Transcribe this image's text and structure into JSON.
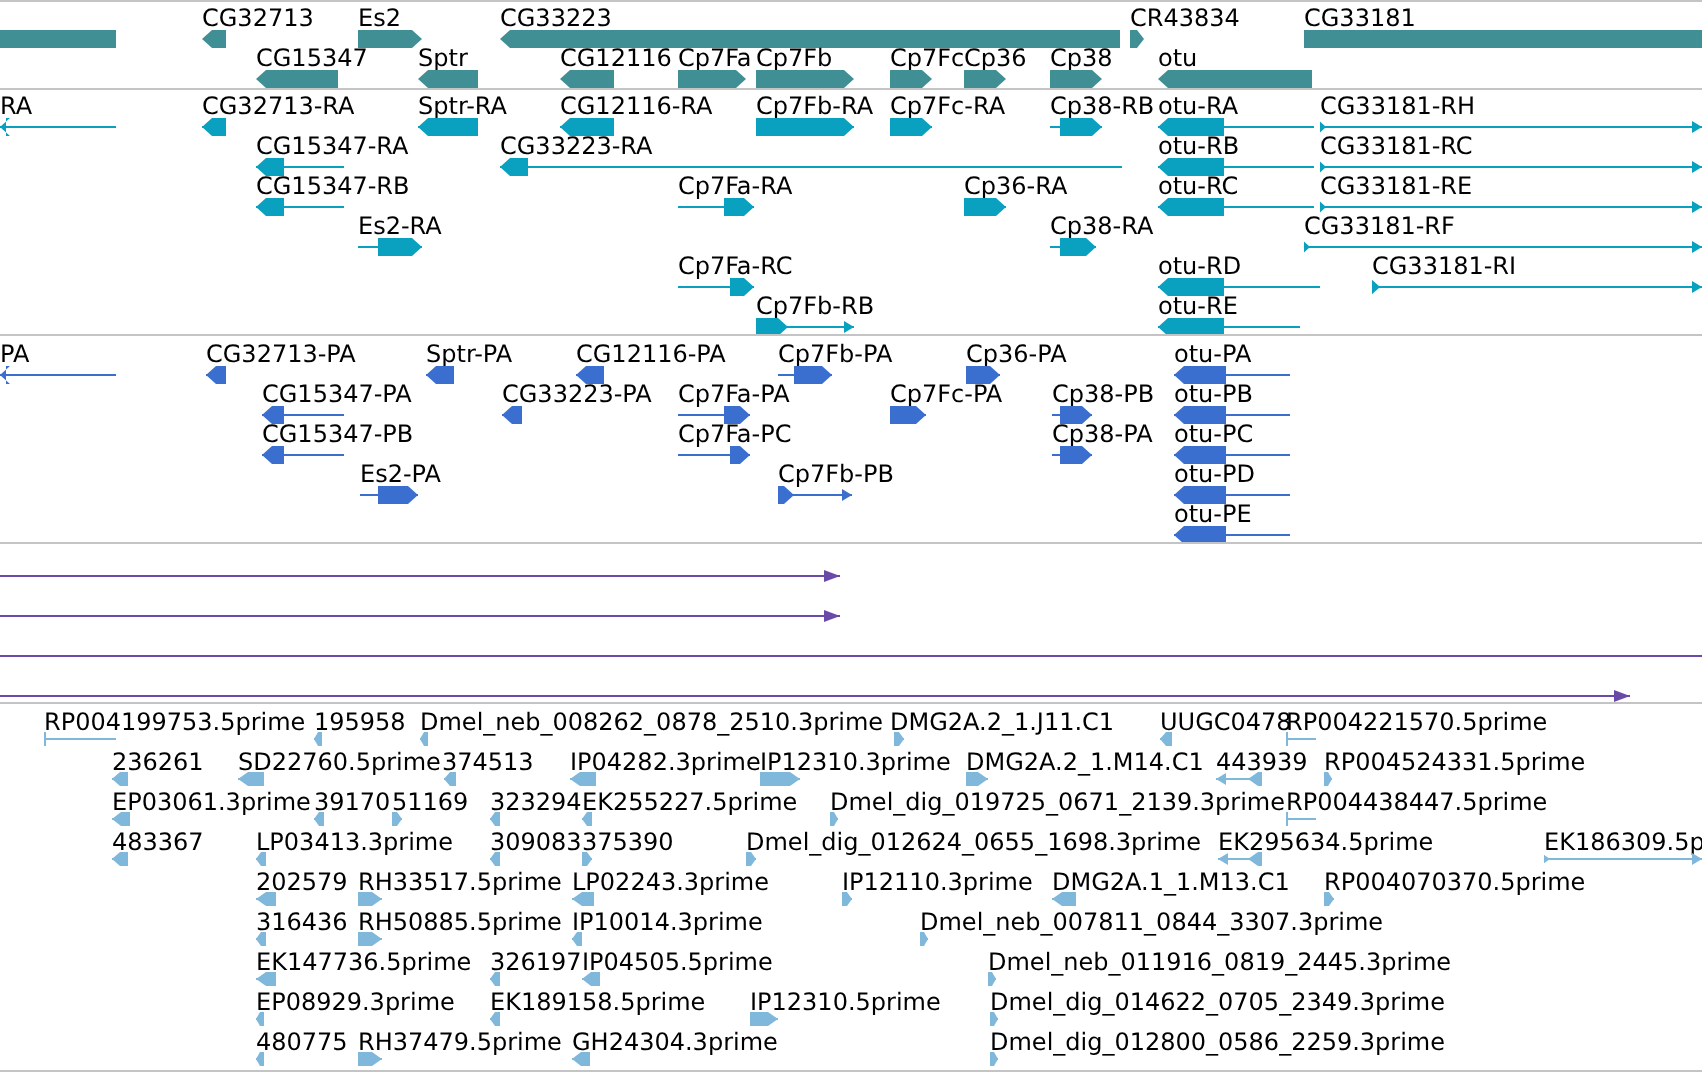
{
  "tracks": [
    {
      "kind": "genes",
      "features": [
        {
          "label": "CG32713"
        },
        {
          "label": "Es2"
        },
        {
          "label": "CG33223"
        },
        {
          "label": "CR43834"
        },
        {
          "label": "CG33181"
        },
        {
          "label": "CG15347"
        },
        {
          "label": "Sptr"
        },
        {
          "label": "CG12116"
        },
        {
          "label": "Cp7Fa"
        },
        {
          "label": "Cp7Fb"
        },
        {
          "label": "Cp7Fc"
        },
        {
          "label": "Cp36"
        },
        {
          "label": "Cp38"
        },
        {
          "label": "otu"
        }
      ]
    },
    {
      "kind": "transcripts",
      "features": [
        {
          "label": "RA"
        },
        {
          "label": "CG32713-RA"
        },
        {
          "label": "Sptr-RA"
        },
        {
          "label": "CG12116-RA"
        },
        {
          "label": "Cp7Fb-RA"
        },
        {
          "label": "Cp7Fc-RA"
        },
        {
          "label": "Cp38-RB"
        },
        {
          "label": "otu-RA"
        },
        {
          "label": "CG33181-RH"
        },
        {
          "label": "CG15347-RA"
        },
        {
          "label": "CG33223-RA"
        },
        {
          "label": "otu-RB"
        },
        {
          "label": "CG33181-RC"
        },
        {
          "label": "CG15347-RB"
        },
        {
          "label": "Cp7Fa-RA"
        },
        {
          "label": "Cp36-RA"
        },
        {
          "label": "otu-RC"
        },
        {
          "label": "CG33181-RE"
        },
        {
          "label": "Es2-RA"
        },
        {
          "label": "Cp38-RA"
        },
        {
          "label": "CG33181-RF"
        },
        {
          "label": "Cp7Fa-RC"
        },
        {
          "label": "otu-RD"
        },
        {
          "label": "CG33181-RI"
        },
        {
          "label": "Cp7Fb-RB"
        },
        {
          "label": "otu-RE"
        }
      ]
    },
    {
      "kind": "proteins",
      "features": [
        {
          "label": "PA"
        },
        {
          "label": "CG32713-PA"
        },
        {
          "label": "Sptr-PA"
        },
        {
          "label": "CG12116-PA"
        },
        {
          "label": "Cp7Fb-PA"
        },
        {
          "label": "Cp36-PA"
        },
        {
          "label": "otu-PA"
        },
        {
          "label": "CG15347-PA"
        },
        {
          "label": "CG33223-PA"
        },
        {
          "label": "Cp7Fa-PA"
        },
        {
          "label": "Cp7Fc-PA"
        },
        {
          "label": "Cp38-PB"
        },
        {
          "label": "otu-PB"
        },
        {
          "label": "CG15347-PB"
        },
        {
          "label": "Cp7Fa-PC"
        },
        {
          "label": "Cp38-PA"
        },
        {
          "label": "otu-PC"
        },
        {
          "label": "Es2-PA"
        },
        {
          "label": "Cp7Fb-PB"
        },
        {
          "label": "otu-PD"
        },
        {
          "label": "otu-PE"
        }
      ]
    },
    {
      "kind": "alignments"
    },
    {
      "kind": "ests",
      "features": [
        {
          "label": "RP004199753.5prime"
        },
        {
          "label": "195958"
        },
        {
          "label": "Dmel_neb_008262_0878_2510.3prime"
        },
        {
          "label": "DMG2A.2_1.J11.C1"
        },
        {
          "label": "UUGC0478"
        },
        {
          "label": "RP004221570.5prime"
        },
        {
          "label": "236261"
        },
        {
          "label": "SD22760.5prime"
        },
        {
          "label": "374513"
        },
        {
          "label": "IP04282.3prime"
        },
        {
          "label": "IP12310.3prime"
        },
        {
          "label": "DMG2A.2_1.M14.C1"
        },
        {
          "label": "443939"
        },
        {
          "label": "RP004524331.5prime"
        },
        {
          "label": "EP03061.3prime"
        },
        {
          "label": "39170"
        },
        {
          "label": "51169"
        },
        {
          "label": "323294"
        },
        {
          "label": "EK255227.5prime"
        },
        {
          "label": "Dmel_dig_019725_0671_2139.3prime"
        },
        {
          "label": "RP004438447.5prime"
        },
        {
          "label": "483367"
        },
        {
          "label": "LP03413.3prime"
        },
        {
          "label": "309083"
        },
        {
          "label": "375390"
        },
        {
          "label": "Dmel_dig_012624_0655_1698.3prime"
        },
        {
          "label": "EK295634.5prime"
        },
        {
          "label": "EK186309.5p"
        },
        {
          "label": "202579"
        },
        {
          "label": "RH33517.5prime"
        },
        {
          "label": "LP02243.3prime"
        },
        {
          "label": "IP12110.3prime"
        },
        {
          "label": "DMG2A.1_1.M13.C1"
        },
        {
          "label": "RP004070370.5prime"
        },
        {
          "label": "316436"
        },
        {
          "label": "RH50885.5prime"
        },
        {
          "label": "IP10014.3prime"
        },
        {
          "label": "Dmel_neb_007811_0844_3307.3prime"
        },
        {
          "label": "EK147736.5prime"
        },
        {
          "label": "326197"
        },
        {
          "label": "IP04505.5prime"
        },
        {
          "label": "Dmel_neb_011916_0819_2445.3prime"
        },
        {
          "label": "EP08929.3prime"
        },
        {
          "label": "EK189158.5prime"
        },
        {
          "label": "IP12310.5prime"
        },
        {
          "label": "Dmel_dig_014622_0705_2349.3prime"
        },
        {
          "label": "480775"
        },
        {
          "label": "RH37479.5prime"
        },
        {
          "label": "GH24304.3prime"
        },
        {
          "label": "Dmel_dig_012800_0586_2259.3prime"
        }
      ]
    }
  ]
}
